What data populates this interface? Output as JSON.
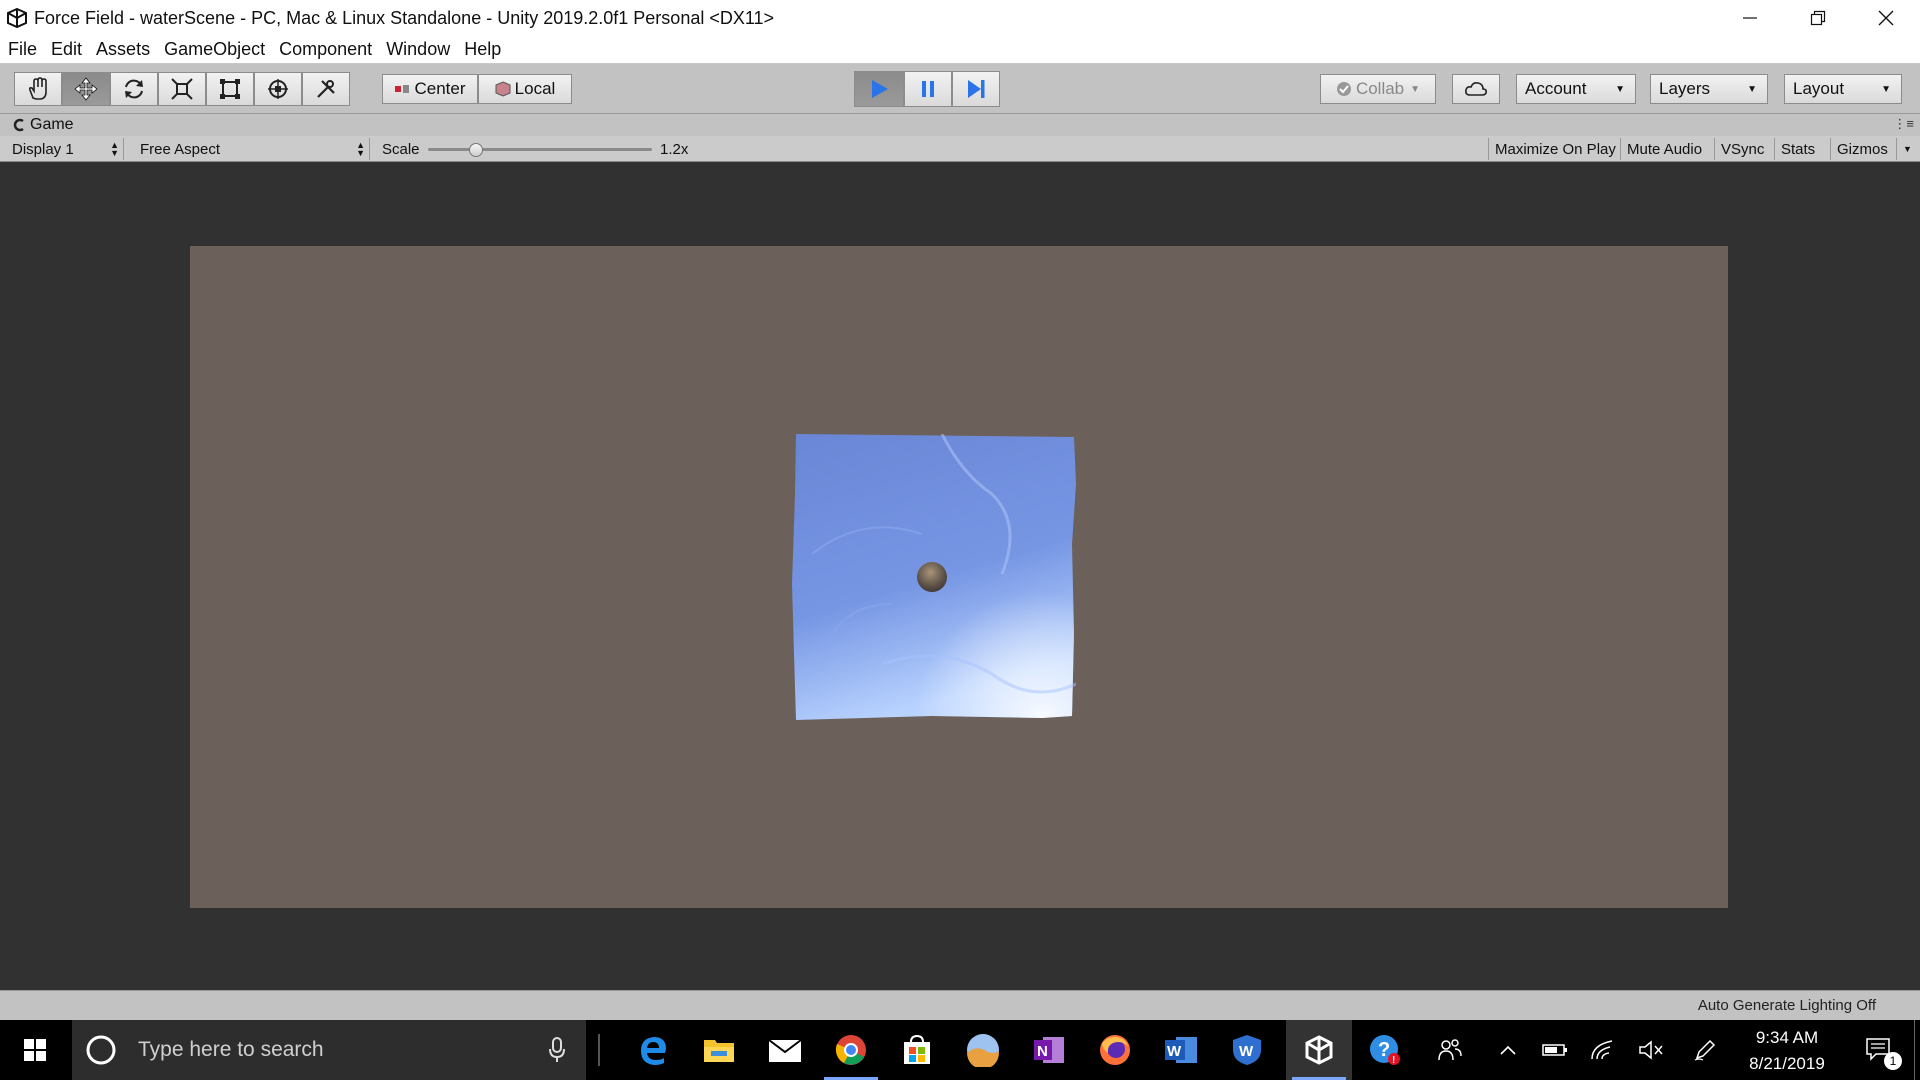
{
  "window": {
    "title": "Force Field - waterScene - PC, Mac & Linux Standalone - Unity 2019.2.0f1 Personal <DX11>"
  },
  "menu": [
    "File",
    "Edit",
    "Assets",
    "GameObject",
    "Component",
    "Window",
    "Help"
  ],
  "toolbar": {
    "tools": [
      "hand-icon",
      "move-icon",
      "rotate-icon",
      "scale-icon",
      "rect-icon",
      "transform-icon",
      "custom-tool-icon"
    ],
    "pivot_mode": "Center",
    "pivot_rotation": "Local",
    "collab": "Collab",
    "account": "Account",
    "layers": "Layers",
    "layout": "Layout",
    "play_state": "playing"
  },
  "game_tab": {
    "title": "Game",
    "display": "Display 1",
    "aspect": "Free Aspect",
    "scale_label": "Scale",
    "scale_value": "1.2x",
    "scale_level": 0.2,
    "toggles": [
      "Maximize On Play",
      "Mute Audio",
      "VSync",
      "Stats",
      "Gizmos"
    ]
  },
  "status": {
    "text": "Auto Generate Lighting Off"
  },
  "taskbar": {
    "search_placeholder": "Type here to search",
    "time": "9:34 AM",
    "date": "8/21/2019",
    "notification_count": "1"
  },
  "colors": {
    "game_background": "#6b615a",
    "water": "#6f8fe0",
    "play_accent": "#2a73e8"
  }
}
